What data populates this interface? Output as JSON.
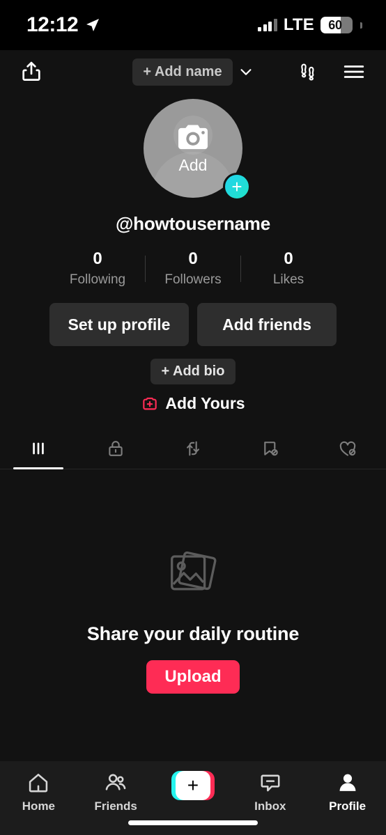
{
  "status_bar": {
    "time": "12:12",
    "location_icon": "location-arrow-icon",
    "network": "LTE",
    "battery_percent": "60"
  },
  "top_nav": {
    "share_icon": "share-icon",
    "add_name_label": "+ Add name",
    "chevron_icon": "chevron-down-icon",
    "footsteps_icon": "footsteps-icon",
    "menu_icon": "hamburger-menu-icon"
  },
  "profile": {
    "avatar": {
      "camera_icon": "camera-icon",
      "add_label": "Add",
      "plus_badge": "+"
    },
    "username": "@howtousername",
    "stats": [
      {
        "value": "0",
        "label": "Following"
      },
      {
        "value": "0",
        "label": "Followers"
      },
      {
        "value": "0",
        "label": "Likes"
      }
    ],
    "buttons": [
      {
        "label": "Set up profile"
      },
      {
        "label": "Add friends"
      }
    ],
    "bio_label": "+ Add bio",
    "add_yours": {
      "icon": "add-yours-sticker-icon",
      "label": "Add Yours"
    }
  },
  "tabs": [
    {
      "name": "videos",
      "icon": "grid-icon",
      "active": true
    },
    {
      "name": "private",
      "icon": "lock-icon",
      "active": false
    },
    {
      "name": "reposts",
      "icon": "repost-arrows-icon",
      "active": false
    },
    {
      "name": "favorites",
      "icon": "bookmark-hidden-icon",
      "active": false
    },
    {
      "name": "liked",
      "icon": "heart-hidden-icon",
      "active": false
    }
  ],
  "empty_state": {
    "image_icon": "photo-stack-icon",
    "title": "Share your daily routine",
    "upload_label": "Upload"
  },
  "bottom_nav": {
    "items": [
      {
        "label": "Home",
        "icon": "home-icon",
        "active": false
      },
      {
        "label": "Friends",
        "icon": "friends-icon",
        "active": false
      },
      {
        "label": "",
        "icon": "create-plus-icon",
        "active": false
      },
      {
        "label": "Inbox",
        "icon": "inbox-icon",
        "active": false
      },
      {
        "label": "Profile",
        "icon": "profile-person-icon",
        "active": true
      }
    ],
    "create_plus": "+"
  },
  "colors": {
    "background": "#121212",
    "accent_pink": "#fe2c55",
    "accent_cyan": "#25f4ee",
    "nav_bar": "#1c1c1c",
    "button_gray": "#2e2e2e"
  }
}
